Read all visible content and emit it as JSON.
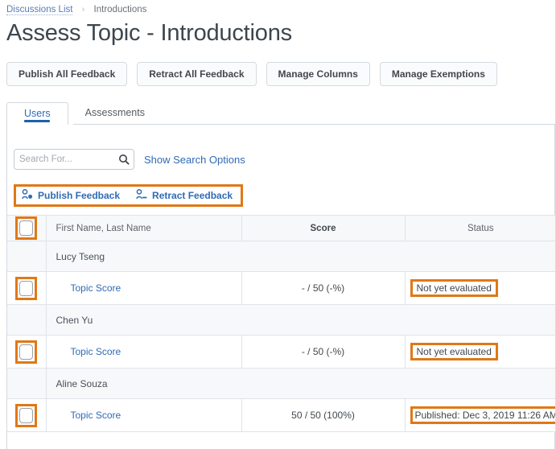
{
  "breadcrumb": {
    "link_label": "Discussions List",
    "separator": "›",
    "current": "Introductions"
  },
  "page_title": "Assess Topic - Introductions",
  "toolbar": {
    "buttons": [
      {
        "label": "Publish All Feedback",
        "name": "publish-all-feedback-button"
      },
      {
        "label": "Retract All Feedback",
        "name": "retract-all-feedback-button"
      },
      {
        "label": "Manage Columns",
        "name": "manage-columns-button"
      },
      {
        "label": "Manage Exemptions",
        "name": "manage-exemptions-button"
      }
    ]
  },
  "tabs": [
    {
      "label": "Users",
      "active": true
    },
    {
      "label": "Assessments",
      "active": false
    }
  ],
  "search": {
    "value": "",
    "placeholder": "Search For...",
    "icon": "search-icon",
    "options_link": "Show Search Options"
  },
  "feedback_actions": {
    "highlight_color": "#e07816",
    "items": [
      {
        "label": "Publish Feedback",
        "icon": "user-publish-icon"
      },
      {
        "label": "Retract Feedback",
        "icon": "user-retract-icon"
      }
    ]
  },
  "table": {
    "headers": {
      "select_all": "",
      "name": "First Name, Last Name",
      "score": "Score",
      "status": "Status"
    },
    "rows": [
      {
        "user": "Lucy Tseng",
        "topic_label": "Topic Score",
        "score": "- / 50 (-%)",
        "status": "Not yet evaluated",
        "status_highlighted": true
      },
      {
        "user": "Chen Yu",
        "topic_label": "Topic Score",
        "score": "- / 50 (-%)",
        "status": "Not yet evaluated",
        "status_highlighted": true
      },
      {
        "user": "Aline Souza",
        "topic_label": "Topic Score",
        "score": "50 / 50 (100%)",
        "status": "Published: Dec 3, 2019 11:26 AM",
        "status_highlighted": true
      }
    ]
  },
  "colors": {
    "link_blue": "#2f6bb5",
    "highlight_orange": "#e07816",
    "tab_active_blue": "#1f5fa9",
    "row_alt_bg": "#f7f8fa"
  }
}
